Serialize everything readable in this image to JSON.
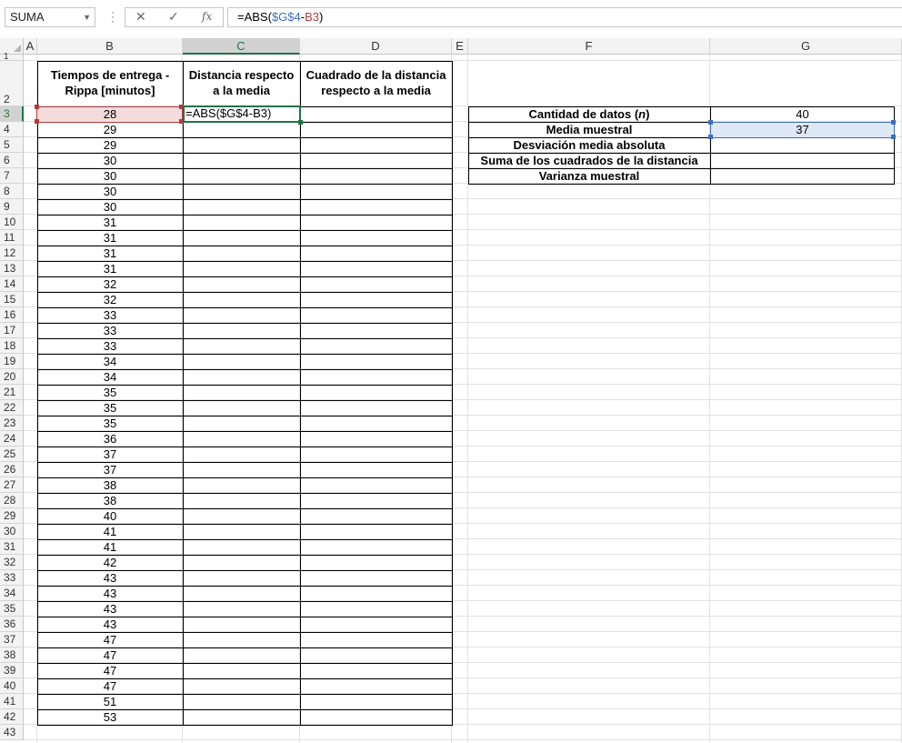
{
  "formula_bar": {
    "name_box": "SUMA",
    "formula_prefix": "=ABS(",
    "formula_ref1": "$G$4",
    "formula_mid": "-",
    "formula_ref2": "B3",
    "formula_suffix": ")",
    "fx_label": "fx"
  },
  "columns": [
    "A",
    "B",
    "C",
    "D",
    "E",
    "F",
    "G"
  ],
  "rows": [
    "1",
    "2",
    "3",
    "4",
    "5",
    "6",
    "7",
    "8",
    "9",
    "10",
    "11",
    "12",
    "13",
    "14",
    "15",
    "16",
    "17",
    "18",
    "19",
    "20",
    "21",
    "22",
    "23",
    "24",
    "25",
    "26",
    "27",
    "28",
    "29",
    "30",
    "31",
    "32",
    "33",
    "34",
    "35",
    "36",
    "37",
    "38",
    "39",
    "40",
    "41",
    "42",
    "43"
  ],
  "table": {
    "header_b_line1": "Tiempos de entrega -",
    "header_b_line2": "Rippa [minutos]",
    "header_c_line1": "Distancia respecto",
    "header_c_line2": "a la media",
    "header_d_line1": "Cuadrado de la distancia",
    "header_d_line2": "respecto a la media",
    "editing_cell": "=ABS($G$4-B3)",
    "values": [
      "28",
      "29",
      "29",
      "30",
      "30",
      "30",
      "30",
      "31",
      "31",
      "31",
      "31",
      "32",
      "32",
      "33",
      "33",
      "33",
      "34",
      "34",
      "35",
      "35",
      "35",
      "36",
      "37",
      "37",
      "38",
      "38",
      "40",
      "41",
      "41",
      "42",
      "43",
      "43",
      "43",
      "43",
      "47",
      "47",
      "47",
      "47",
      "51",
      "53"
    ]
  },
  "summary": [
    {
      "label_pre": "Cantidad de datos (",
      "label_em": "n",
      "label_post": ")",
      "value": "40"
    },
    {
      "label_pre": "Media muestral",
      "label_em": "",
      "label_post": "",
      "value": "37"
    },
    {
      "label_pre": "Desviación media absoluta",
      "label_em": "",
      "label_post": "",
      "value": ""
    },
    {
      "label_pre": "Suma de los cuadrados de la distancia",
      "label_em": "",
      "label_post": "",
      "value": ""
    },
    {
      "label_pre": "Varianza muestral",
      "label_em": "",
      "label_post": "",
      "value": ""
    }
  ],
  "colors": {
    "active_header": "#217346",
    "ref_blue": "#3c6fbe",
    "ref_red": "#b63a3a",
    "red_fill": "#f4dcdc",
    "blue_fill": "#dfe8f6"
  }
}
